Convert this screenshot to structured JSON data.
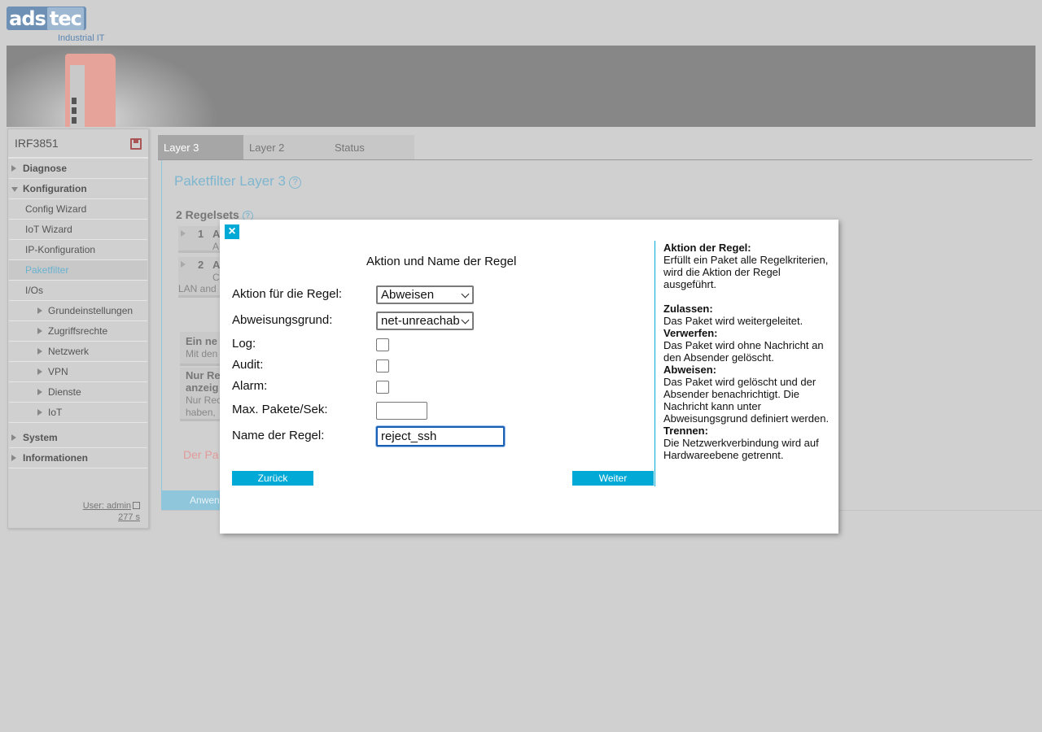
{
  "header": {
    "logo_ads": "ads",
    "logo_tec": "tec",
    "logo_sub": "Industrial IT"
  },
  "sidebar": {
    "title": "IRF3851",
    "items": [
      {
        "label": "Diagnose",
        "level": "top",
        "expanded": false
      },
      {
        "label": "Konfiguration",
        "level": "top",
        "expanded": true
      },
      {
        "label": "Config Wizard",
        "level": "sub"
      },
      {
        "label": "IoT Wizard",
        "level": "sub"
      },
      {
        "label": "IP-Konfiguration",
        "level": "sub"
      },
      {
        "label": "Paketfilter",
        "level": "sub",
        "active": true
      },
      {
        "label": "I/Os",
        "level": "sub"
      },
      {
        "label": "Grundeinstellungen",
        "level": "sub2"
      },
      {
        "label": "Zugriffsrechte",
        "level": "sub2"
      },
      {
        "label": "Netzwerk",
        "level": "sub2"
      },
      {
        "label": "VPN",
        "level": "sub2"
      },
      {
        "label": "Dienste",
        "level": "sub2"
      },
      {
        "label": "IoT",
        "level": "sub2"
      },
      {
        "label": "System",
        "level": "top",
        "expanded": false
      },
      {
        "label": "Informationen",
        "level": "top",
        "expanded": false
      }
    ],
    "user": "User: admin",
    "session": "277 s"
  },
  "tabs": [
    {
      "label": "Layer 3",
      "active": true
    },
    {
      "label": "Layer 2",
      "active": false
    },
    {
      "label": "Status",
      "active": false
    }
  ],
  "main": {
    "title": "Paketfilter Layer 3",
    "regelsets": "2 Regelsets",
    "rows": [
      {
        "num": "1",
        "head": "A",
        "sub": "A"
      },
      {
        "num": "2",
        "head": "A",
        "sub": "C"
      }
    ],
    "row2_extra": "LAN and",
    "info1_head": "Ein ne",
    "info1_sub": "Mit den",
    "info2_head1": "Nur Re",
    "info2_head2": "anzeig",
    "info2_sub1": "Nur Rec",
    "info2_sub2": "haben,",
    "red_text": "Der Pa",
    "apply_label": "Anwen"
  },
  "dialog": {
    "close": "×",
    "title": "Aktion und Name der Regel",
    "fields": {
      "action_label": "Aktion für die Regel:",
      "action_value": "Abweisen",
      "reason_label": "Abweisungsgrund:",
      "reason_value": "net-unreachable",
      "log_label": "Log:",
      "audit_label": "Audit:",
      "alarm_label": "Alarm:",
      "maxpackets_label": "Max. Pakete/Sek:",
      "maxpackets_value": "",
      "name_label": "Name der Regel:",
      "name_value": "reject_ssh"
    },
    "back_label": "Zurück",
    "next_label": "Weiter",
    "help": {
      "h1": "Aktion der Regel:",
      "p1": "Erfüllt ein Paket alle Regelkriterien, wird die Aktion der Regel ausgeführt.",
      "h2": "Zulassen:",
      "p2": "Das Paket wird weitergeleitet.",
      "h3": "Verwerfen:",
      "p3": "Das Paket wird ohne Nachricht an den Absender gelöscht.",
      "h4": "Abweisen:",
      "p4": "Das Paket wird gelöscht und der Absender benachrichtigt. Die Nachricht kann unter Abweisungsgrund definiert werden.",
      "h5": "Trennen:",
      "p5": "Die Netzwerkverbindung wird auf Hardwareebene getrennt."
    }
  },
  "colors": {
    "accent": "#00a9d6",
    "banner": "#878787",
    "active_link": "#6ab2d0"
  }
}
